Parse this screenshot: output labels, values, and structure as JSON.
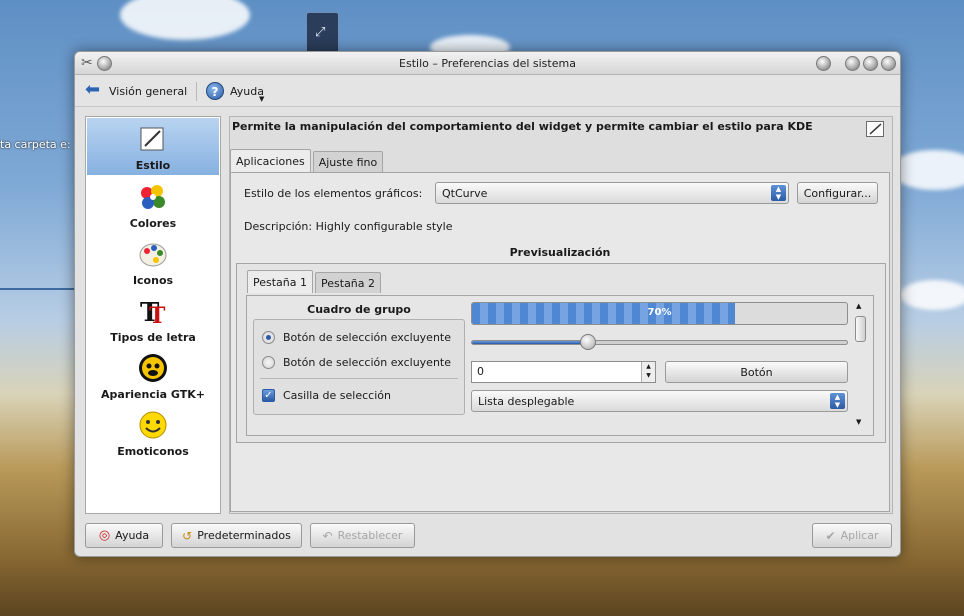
{
  "desktop": {
    "partial_text": "ta carpeta e:"
  },
  "window": {
    "title": "Estilo – Preferencias del sistema"
  },
  "toolbar": {
    "overview_label": "Visión general",
    "help_label": "Ayuda"
  },
  "sidebar": {
    "items": [
      {
        "label": "Estilo",
        "icon": "style-icon",
        "selected": true
      },
      {
        "label": "Colores",
        "icon": "colors-icon"
      },
      {
        "label": "Iconos",
        "icon": "icons-icon"
      },
      {
        "label": "Tipos de letra",
        "icon": "fonts-icon"
      },
      {
        "label": "Apariencia GTK+",
        "icon": "gtk-appearance-icon"
      },
      {
        "label": "Emoticonos",
        "icon": "emoticons-icon"
      }
    ]
  },
  "content": {
    "heading": "Permite la manipulación del comportamiento del widget y permite cambiar el estilo para KDE",
    "tabs": [
      "Aplicaciones",
      "Ajuste fino"
    ],
    "style_label": "Estilo de los elementos gráficos:",
    "style_value": "QtCurve",
    "configure_label": "Configurar...",
    "description": "Descripción: Highly configurable style",
    "preview_title": "Previsualización"
  },
  "preview": {
    "tabs": [
      "Pestaña 1",
      "Pestaña 2"
    ],
    "group_title": "Cuadro de grupo",
    "radio1": "Botón de selección excluyente",
    "radio2": "Botón de selección excluyente",
    "checkbox": "Casilla de selección",
    "progress": 70,
    "progress_text": "70%",
    "slider": 0.31,
    "spin_value": "0",
    "button_label": "Botón",
    "dropdown_label": "Lista desplegable"
  },
  "footer": {
    "help": "Ayuda",
    "defaults": "Predeterminados",
    "reset": "Restablecer",
    "apply": "Aplicar"
  },
  "colors": {
    "accent": "#2c5aa6",
    "selection": "#86b1e0"
  }
}
